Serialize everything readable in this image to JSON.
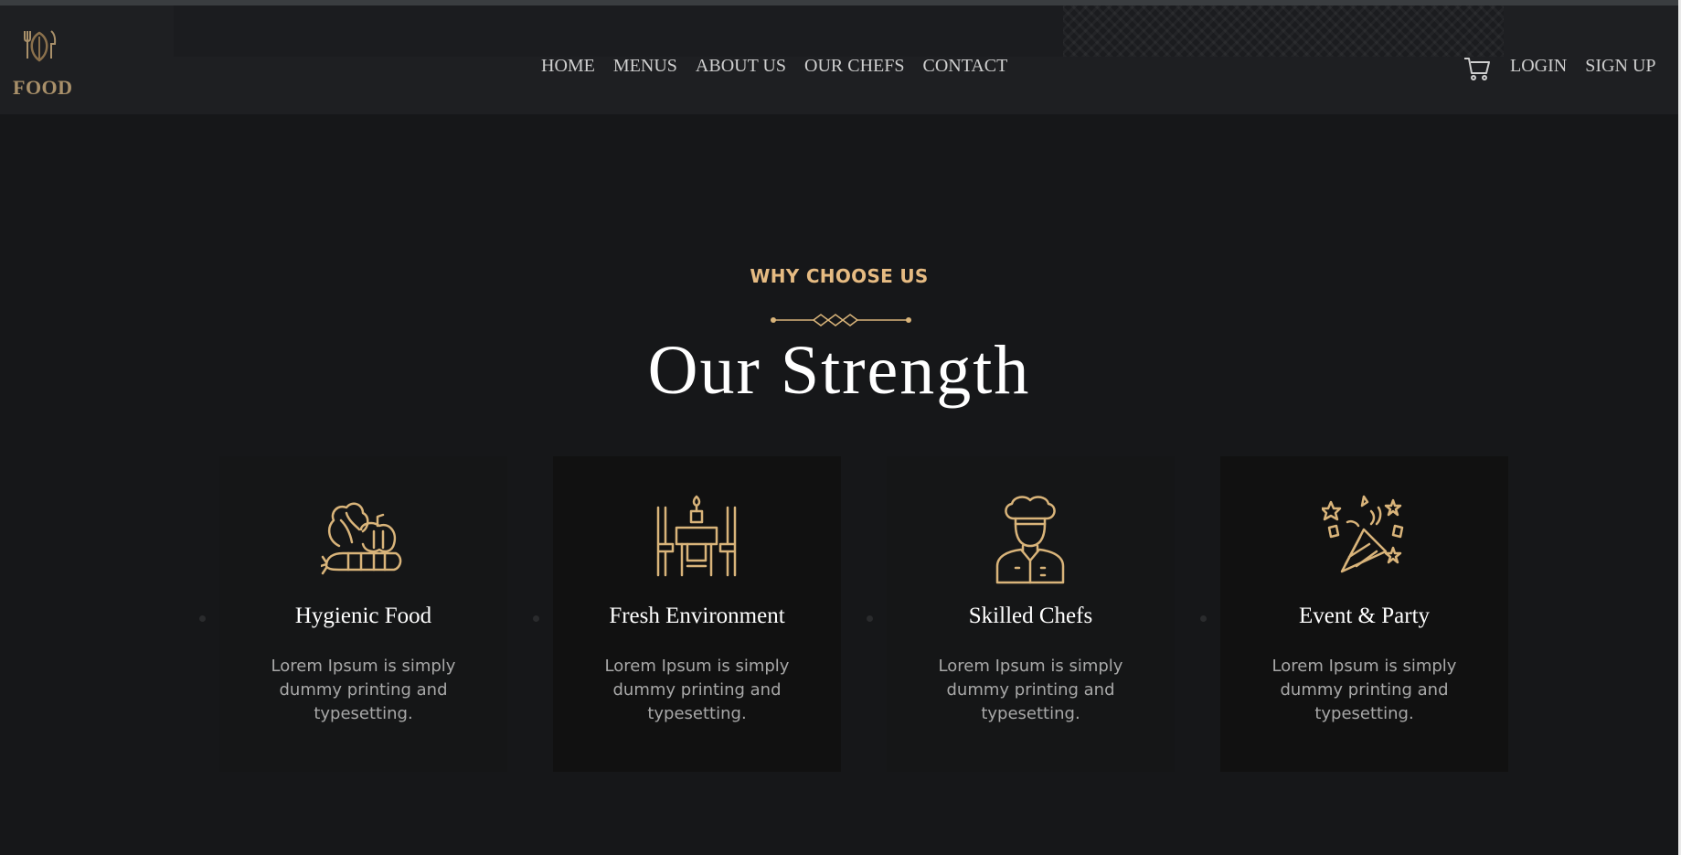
{
  "brand": {
    "name": "FOOD",
    "logo_icon": "utensils-leaf-icon"
  },
  "nav": {
    "items": [
      "HOME",
      "MENUS",
      "ABOUT US",
      "OUR CHEFS",
      "CONTACT"
    ]
  },
  "header_right": {
    "cart_icon": "cart-icon",
    "login": "LOGIN",
    "signup": "SIGN UP"
  },
  "section": {
    "kicker": "WHY CHOOSE US",
    "title": "Our Strength"
  },
  "features": [
    {
      "icon": "vegetables-icon",
      "title": "Hygienic Food",
      "text": "Lorem Ipsum is simply dummy printing and typesetting."
    },
    {
      "icon": "dining-table-icon",
      "title": "Fresh Environment",
      "text": "Lorem Ipsum is simply dummy printing and typesetting."
    },
    {
      "icon": "chef-icon",
      "title": "Skilled Chefs",
      "text": "Lorem Ipsum is simply dummy printing and typesetting."
    },
    {
      "icon": "party-popper-icon",
      "title": "Event & Party",
      "text": "Lorem Ipsum is simply dummy printing and typesetting."
    }
  ],
  "colors": {
    "accent": "#e6bb82",
    "icon_gold": "#d9b47a",
    "background": "#161719",
    "header": "#1e1f22",
    "card": "#111111"
  }
}
